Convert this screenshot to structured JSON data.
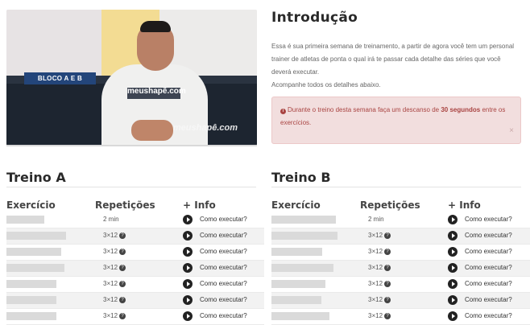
{
  "video": {
    "label": "BLOCO A E B",
    "shirt_text": "meushapê.com",
    "watermark": "meushapê.com"
  },
  "intro": {
    "title": "Introdução",
    "paragraph1": "Essa é sua primeira semana de treinamento, a partir de agora você tem um personal trainer de atletas de ponta o qual irá te passar cada detalhe das séries que você deverá executar.",
    "paragraph2": "Acompanhe todos os detalhes abaixo."
  },
  "alert": {
    "icon": "info-icon",
    "before": "Durante o treino desta semana faça um descanso de ",
    "bold": "30 segundos",
    "after": " entre os exercícios.",
    "close": "×"
  },
  "treinos": [
    {
      "title": "Treino A",
      "columns": [
        "Exercício",
        "Repetições",
        "+ Info"
      ],
      "rows": [
        {
          "reps": "2 min",
          "info": "Como executar?"
        },
        {
          "reps": "3×12",
          "info": "Como executar?"
        },
        {
          "reps": "3×12",
          "info": "Como executar?"
        },
        {
          "reps": "3×12",
          "info": "Como executar?"
        },
        {
          "reps": "3×12",
          "info": "Como executar?"
        },
        {
          "reps": "3×12",
          "info": "Como executar?"
        },
        {
          "reps": "3×12",
          "info": "Como executar?"
        }
      ]
    },
    {
      "title": "Treino B",
      "columns": [
        "Exercício",
        "Repetições",
        "+ Info"
      ],
      "rows": [
        {
          "reps": "2 min",
          "info": "Como executar?"
        },
        {
          "reps": "3×12",
          "info": "Como executar?"
        },
        {
          "reps": "3×12",
          "info": "Como executar?"
        },
        {
          "reps": "3×12",
          "info": "Como executar?"
        },
        {
          "reps": "3×12",
          "info": "Como executar?"
        },
        {
          "reps": "3×12",
          "info": "Como executar?"
        },
        {
          "reps": "3×12",
          "info": "Como executar?"
        }
      ]
    }
  ]
}
